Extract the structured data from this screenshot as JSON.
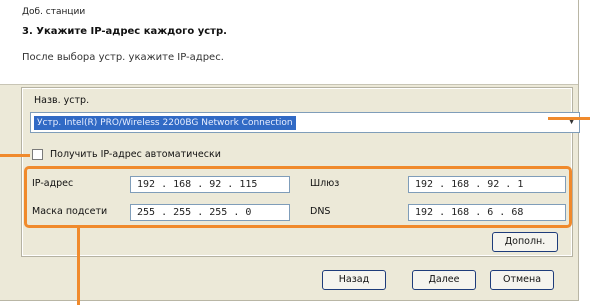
{
  "window": {
    "title": "Доб. станции",
    "step_title": "3. Укажите IP-адрес каждого устр.",
    "step_subtitle": "После выбора устр. укажите IP-адрес."
  },
  "device": {
    "label": "Назв. устр.",
    "selected": "Устр. Intel(R) PRO/Wireless 2200BG Network Connection"
  },
  "auto_ip": {
    "label": "Получить IP-адрес автоматически",
    "checked": false
  },
  "fields": {
    "ip_label": "IP-адрес",
    "ip_value": "192 . 168 . 92 . 115",
    "mask_label": "Маска подсети",
    "mask_value": "255 . 255 . 255 . 0",
    "gateway_label": "Шлюз",
    "gateway_value": "192 . 168 . 92 . 1",
    "dns_label": "DNS",
    "dns_value": "192 . 168 . 6 . 68"
  },
  "buttons": {
    "advanced": "Дополн.",
    "back": "Назад",
    "next": "Далее",
    "cancel": "Отмена"
  },
  "colors": {
    "callout": "#f08a2c",
    "dialog_bg": "#ece9d8",
    "selection": "#316ac5"
  }
}
